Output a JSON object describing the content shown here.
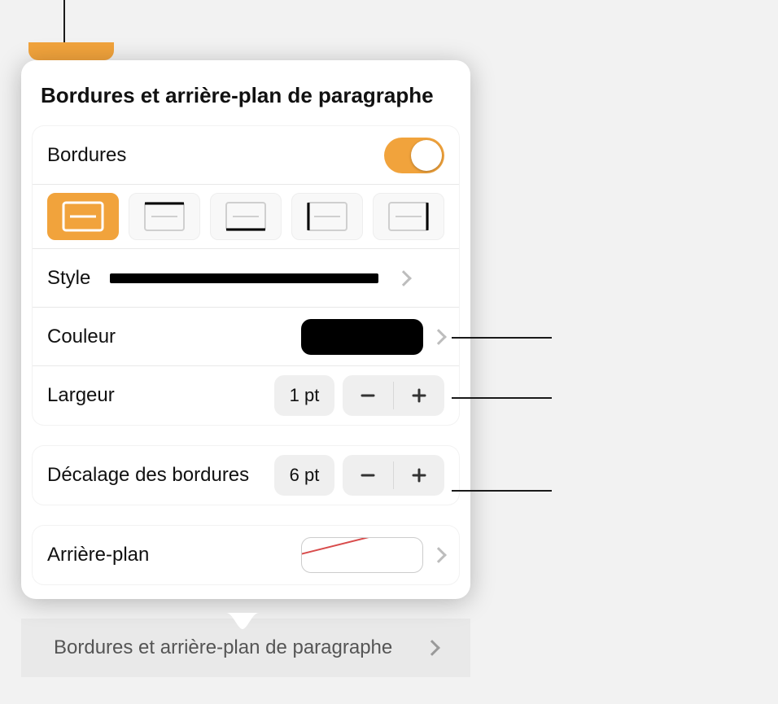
{
  "title": "Bordures et arrière-plan de paragraphe",
  "borders_section": {
    "label": "Bordures",
    "enabled": true,
    "positions": [
      "all",
      "top",
      "right",
      "bottom",
      "left"
    ]
  },
  "style_row": {
    "label": "Style"
  },
  "color_row": {
    "label": "Couleur",
    "value": "#000000"
  },
  "width_row": {
    "label": "Largeur",
    "value": "1 pt"
  },
  "offset_row": {
    "label": "Décalage des bordures",
    "value": "6 pt"
  },
  "background_row": {
    "label": "Arrière-plan"
  },
  "footer_peek": "Bordures et arrière-plan de paragraphe"
}
